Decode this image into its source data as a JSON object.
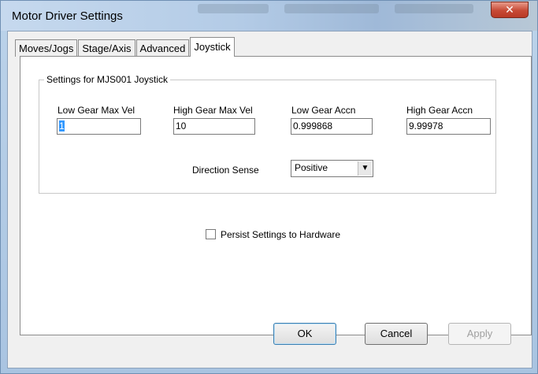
{
  "window": {
    "title": "Motor Driver Settings",
    "close_symbol": "✕"
  },
  "tabs": [
    {
      "label": "Moves/Jogs",
      "active": false
    },
    {
      "label": "Stage/Axis",
      "active": false
    },
    {
      "label": "Advanced",
      "active": false
    },
    {
      "label": "Joystick",
      "active": true
    }
  ],
  "joystick": {
    "group_title": "Settings for MJS001 Joystick",
    "fields": [
      {
        "label": "Low Gear Max Vel",
        "value": "1"
      },
      {
        "label": "High Gear Max Vel",
        "value": "10"
      },
      {
        "label": "Low Gear Accn",
        "value": "0.999868"
      },
      {
        "label": "High Gear Accn",
        "value": "9.99978"
      }
    ],
    "direction_sense": {
      "label": "Direction Sense",
      "value": "Positive"
    },
    "persist": {
      "label": "Persist Settings to Hardware",
      "checked": false
    }
  },
  "buttons": {
    "ok": "OK",
    "cancel": "Cancel",
    "apply": "Apply"
  },
  "colors": {
    "title_bar": "#b3cbe6",
    "close_button": "#c74a35",
    "selection": "#3399ff"
  }
}
